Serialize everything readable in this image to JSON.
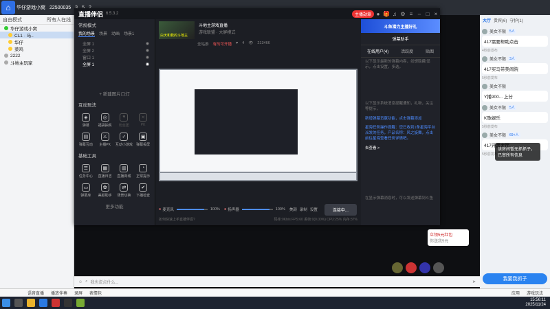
{
  "topbar": {
    "app_name": "华仔游戏小窝",
    "room_id": "22500035",
    "viewers": "3",
    "likes": "5",
    "hearts": "2"
  },
  "left_panel": {
    "mode": "自由模式",
    "all_online": "所有人在线",
    "items": [
      {
        "label": "华仔游戏小窝",
        "sub": false,
        "selected": false
      },
      {
        "label": "CL1 · 马..",
        "sub": true,
        "selected": true
      },
      {
        "label": "华仔",
        "sub": true,
        "selected": false
      },
      {
        "label": "菜鸡",
        "sub": true,
        "selected": false
      },
      {
        "label": "2222",
        "sub": false,
        "selected": false
      },
      {
        "label": "斗地主玩家",
        "sub": false,
        "selected": false
      }
    ]
  },
  "studio": {
    "brand": "直播伴侣",
    "version": "6.5.3.2",
    "live_status": "主播勋章",
    "help": "开播指南",
    "share": "分享",
    "scene_mode": "常规模式",
    "scene_tabs": [
      "我的场景",
      "场景",
      "动画",
      "场景1"
    ],
    "scenes": [
      "全屏 1",
      "全屏 2",
      "窗口 1",
      "全屏 1"
    ],
    "add_source": "+ 新建图片口灯",
    "interact_title": "互动玩法",
    "interact_tools": [
      {
        "label": "弹幕",
        "dim": false
      },
      {
        "label": "福袋抽奖",
        "dim": false
      },
      {
        "label": "粉丝团",
        "dim": true
      },
      {
        "label": "PK",
        "dim": true
      },
      {
        "label": "弹幕互动",
        "dim": false
      },
      {
        "label": "主播PK",
        "dim": false
      },
      {
        "label": "互动小游戏",
        "dim": false
      },
      {
        "label": "弹幕投屏",
        "dim": false
      }
    ],
    "base_title": "基础工具",
    "base_tools": [
      {
        "label": "任务中心"
      },
      {
        "label": "直播日志"
      },
      {
        "label": "直播商城"
      },
      {
        "label": "正常提示"
      },
      {
        "label": "弹幕库"
      },
      {
        "label": "美颜助手"
      },
      {
        "label": "场景切换"
      },
      {
        "label": "下播检查"
      }
    ],
    "more": "更多功能",
    "room_title": "斗地主游戏直播",
    "room_category": "游戏联盟 · 大屏模式",
    "room_thumb_text": "白天和我的斗地主",
    "room_stats": {
      "likes": "4",
      "online": "213466",
      "open": "全站游",
      "hot": "有的可开播"
    },
    "mic_label": "麦克风",
    "mic_volume": "100%",
    "speaker_label": "扬声器",
    "speaker_volume": "100%",
    "mic_level": 0.9,
    "speaker_level": 0.9,
    "btn_beauty": "美颜",
    "btn_record": "录制",
    "btn_settings": "设置",
    "go_live": "连接中...",
    "status_tip": "如何快速上手直播伴侣?",
    "status_stats": "码率:0Kb/s  FPS:60  丢帧:0(0.00%)  CPU:25%  内存:37%",
    "banner": "斗鱼潜力主播好礼",
    "right_tabs": [
      "弹幕助手",
      "在线用户(4)",
      "活跃度",
      "贴图"
    ],
    "right_text_1": "以下显示最新的弹幕内容，如想隐藏/显示，点击设置，多选，",
    "right_text_2": "以下显示系统消息提醒通知，礼物，关注等提示，",
    "right_highlight_1": "新增弹幕贡献功能，点击弹幕添加",
    "right_highlight_2": "星海任务操作提醒：您已收到1条星海平台派发的任务，产品名称：风之旋舞，点击前往星海查看任务详情吧。",
    "right_go": "去查看 >",
    "right_empty": "在显示弹幕消息时，可以发送弹幕到斗鱼"
  },
  "promo": {
    "text": "立领5元红包",
    "sub": "你送我5元"
  },
  "chat": {
    "tabs": [
      "大厅",
      "贵宾(6)",
      "守护(1)"
    ],
    "messages": [
      {
        "user": "美女不限",
        "badge": "5人",
        "text": "417需要帮助点击",
        "tag": "4秒前发布"
      },
      {
        "user": "美女不限",
        "badge": "3人",
        "text": "417买马带美闹院",
        "tag": "5秒前发布"
      },
      {
        "user": "美女不限",
        "badge": "",
        "text": "Y播900... 上分",
        "tag": ""
      },
      {
        "user": "美女不限",
        "badge": "5人",
        "text": "K歌娱乐",
        "tag": "5秒前发布"
      },
      {
        "user": "美女不限",
        "badge": "69+人",
        "text": "417开黑大厅",
        "tag": "5秒前发布"
      }
    ],
    "join": "我要我抓子",
    "toast": "该房间暂无抓抓子，已审所有信息"
  },
  "inputbar": {
    "placeholder": "我也说点什么..."
  },
  "bottombar": {
    "items": [
      "语音直播",
      "播放伴奏",
      "录屏",
      "表情包"
    ],
    "right": "应用",
    "game": "游戏玩法"
  },
  "taskbar": {
    "time": "15:56:11",
    "date": "2025/11/24"
  }
}
